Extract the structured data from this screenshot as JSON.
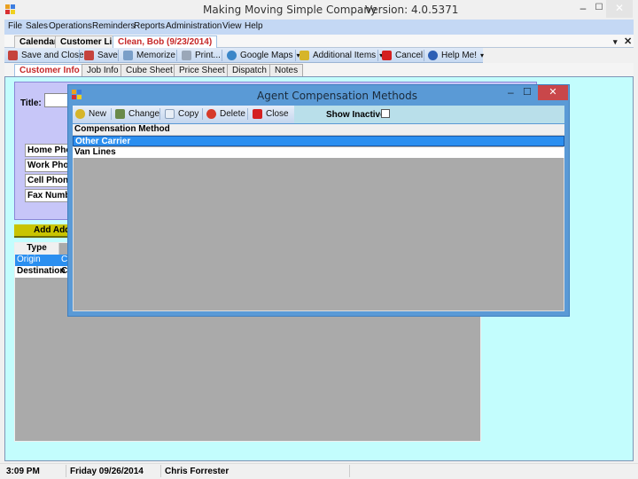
{
  "window": {
    "title": "Making Moving Simple Company",
    "version": "Version: 4.0.5371",
    "minimize": "–",
    "maximize": "☐",
    "close": "✕"
  },
  "menu": [
    "File",
    "Sales",
    "Operations",
    "Reminders",
    "Reports",
    "Administration",
    "View",
    "Help"
  ],
  "doc_tabs": [
    {
      "label": "Calendar",
      "active": false
    },
    {
      "label": "Customer List",
      "active": false
    },
    {
      "label": "Clean, Bob  (9/23/2014)",
      "active": true
    }
  ],
  "doc_controls": {
    "dropdown": "▾",
    "close": "✕"
  },
  "toolbar": {
    "save_close": "Save and Close",
    "save": "Save",
    "memorize": "Memorize",
    "print": "Print...",
    "google_maps": "Google Maps",
    "additional_items": "Additional Items",
    "cancel": "Cancel",
    "help": "Help Me!",
    "dropdown_arrow": "▾"
  },
  "form_tabs": [
    {
      "label": "Customer Info",
      "active": true
    },
    {
      "label": "Job Info",
      "active": false
    },
    {
      "label": "Cube Sheet",
      "active": false
    },
    {
      "label": "Price Sheet",
      "active": false
    },
    {
      "label": "Dispatch",
      "active": false
    },
    {
      "label": "Notes",
      "active": false
    }
  ],
  "customer_form": {
    "title_label": "Title:",
    "title_value": "",
    "phone_labels": [
      "Home Phone",
      "Work Phone",
      "Cell Phone",
      "Fax Number"
    ],
    "add_address_button": "Add Address"
  },
  "address_grid": {
    "header": "Type",
    "rows": [
      {
        "type": "Origin",
        "col2": "C",
        "selected": true
      },
      {
        "type": "Destination",
        "col2": "C",
        "selected": false
      }
    ]
  },
  "dialog": {
    "title": "Agent Compensation Methods",
    "minimize": "–",
    "maximize": "☐",
    "close": "✕",
    "toolbar": {
      "new": "New",
      "change": "Change",
      "copy": "Copy",
      "delete": "Delete",
      "close": "Close"
    },
    "show_inactive_label": "Show Inactive",
    "show_inactive_checked": false,
    "grid": {
      "header": "Compensation Method",
      "rows": [
        {
          "name": "Other Carrier",
          "selected": true
        },
        {
          "name": "Van Lines",
          "selected": false
        }
      ]
    }
  },
  "status_bar": {
    "time": "3:09 PM",
    "date": "Friday 09/26/2014",
    "user": "Chris Forrester"
  },
  "colors": {
    "accent_red": "#c62828",
    "selection_blue": "#2b8ff0",
    "content_bg": "#c3fdfd",
    "panel_purple": "#c7c6f8",
    "dialog_frame": "#5a9ad6",
    "add_button_yellow": "#c9c400"
  }
}
